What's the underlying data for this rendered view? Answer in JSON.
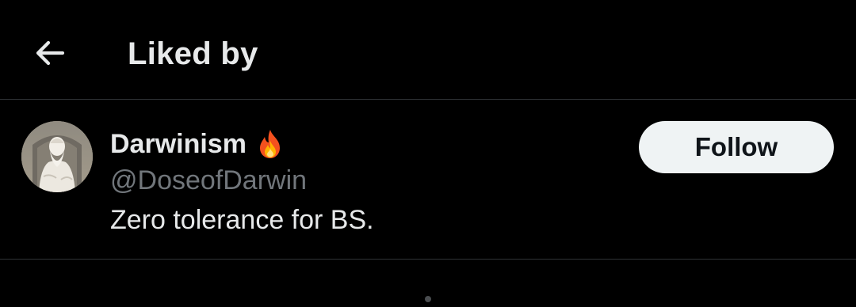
{
  "header": {
    "back_icon": "arrow-left-icon",
    "title": "Liked by"
  },
  "user": {
    "display_name": "Darwinism",
    "emoji_icon": "fire-icon",
    "handle": "@DoseofDarwin",
    "bio": "Zero tolerance for BS.",
    "follow_label": "Follow",
    "avatar_icon": "darwin-statue-avatar"
  },
  "colors": {
    "background": "#000000",
    "primary_text": "#e7e9ea",
    "secondary_text": "#71767b",
    "divider": "#2f3336",
    "follow_bg": "#eff3f4",
    "follow_text": "#0f1419"
  }
}
